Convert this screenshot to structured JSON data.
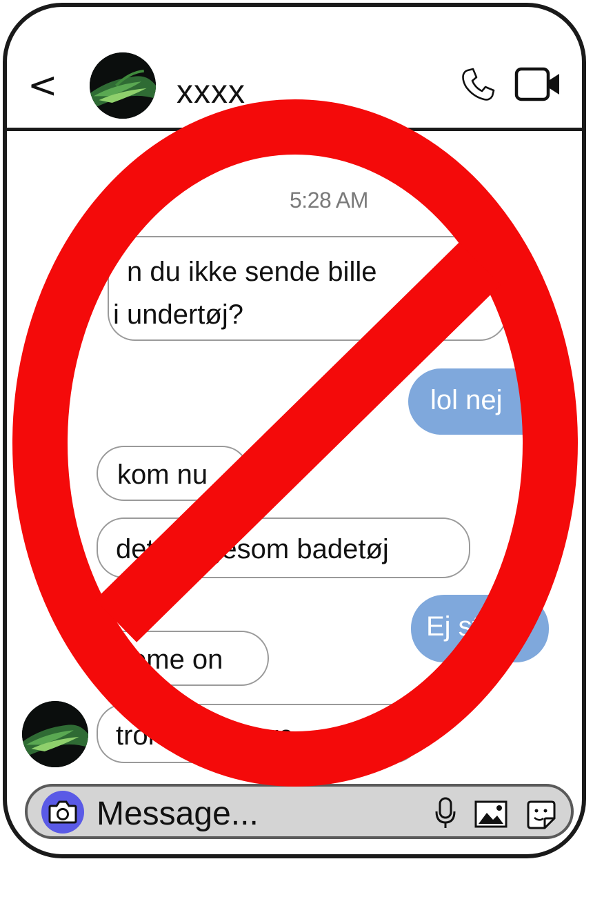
{
  "header": {
    "back_label": "<",
    "contact_name": "xxxx"
  },
  "chat": {
    "timestamp": "5:28 AM",
    "messages": [
      {
        "side": "in",
        "line1": "n du ikke sende bille",
        "line2": "i undertøj?"
      },
      {
        "side": "out",
        "text": "lol nej"
      },
      {
        "side": "in",
        "text": "kom nu"
      },
      {
        "side": "in",
        "text": "det er ligesom badetøj"
      },
      {
        "side": "out",
        "text": "Ej stop"
      },
      {
        "side": "in",
        "text": "come on"
      },
      {
        "side": "in",
        "text": "tror du hvar ve"
      }
    ]
  },
  "composer": {
    "placeholder": "Message..."
  },
  "icons": {
    "back": "chevron-left-icon",
    "call": "phone-icon",
    "video": "video-camera-icon",
    "camera": "camera-icon",
    "mic": "microphone-icon",
    "gallery": "image-icon",
    "sticker": "sticker-icon"
  },
  "colors": {
    "outgoing_bubble": "#7fa8dc",
    "camera_button": "#5a5ae6",
    "prohibition_sign": "#f40a0a"
  }
}
